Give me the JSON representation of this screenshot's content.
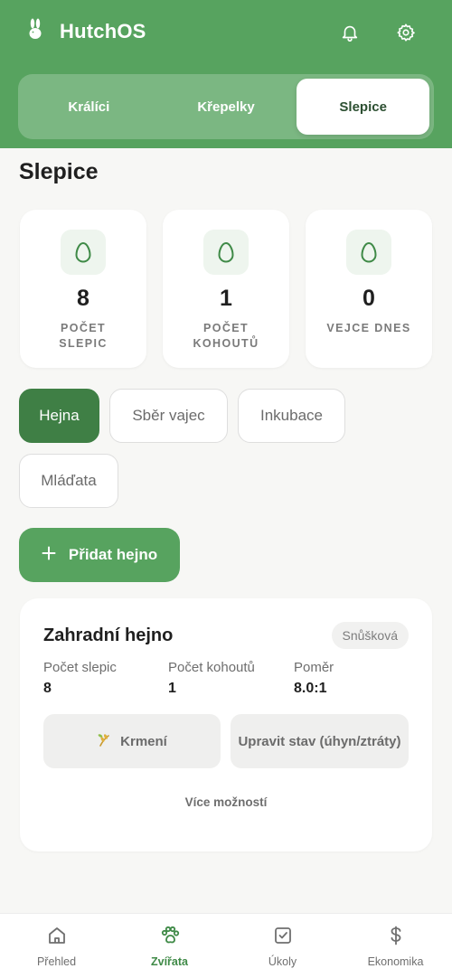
{
  "app": {
    "name": "HutchOS"
  },
  "header": {
    "icons": [
      "bell-icon",
      "gear-icon"
    ]
  },
  "tabs": [
    {
      "label": "Králíci",
      "active": false
    },
    {
      "label": "Křepelky",
      "active": false
    },
    {
      "label": "Slepice",
      "active": true
    }
  ],
  "page": {
    "title": "Slepice"
  },
  "stats": [
    {
      "value": "8",
      "label": "POČET SLEPIC",
      "icon": "egg-icon"
    },
    {
      "value": "1",
      "label": "POČET KOHOUTŮ",
      "icon": "egg-icon"
    },
    {
      "value": "0",
      "label": "VEJCE DNES",
      "icon": "egg-icon"
    }
  ],
  "filters": [
    {
      "label": "Hejna",
      "active": true
    },
    {
      "label": "Sběr vajec",
      "active": false
    },
    {
      "label": "Inkubace",
      "active": false
    },
    {
      "label": "Mláďata",
      "active": false
    }
  ],
  "add_button": {
    "label": "Přidat hejno"
  },
  "flock_card": {
    "title": "Zahradní hejno",
    "badge": "Snůšková",
    "fields": [
      {
        "label": "Počet slepic",
        "value": "8"
      },
      {
        "label": "Počet kohoutů",
        "value": "1"
      },
      {
        "label": "Poměr",
        "value": "8.0:1"
      }
    ],
    "actions": {
      "feed": "Krmení",
      "update": "Upravit stav (úhyn/ztráty)"
    },
    "more": "Více možností"
  },
  "nav": [
    {
      "label": "Přehled",
      "icon": "home-icon",
      "active": false
    },
    {
      "label": "Zvířata",
      "icon": "paw-icon",
      "active": true
    },
    {
      "label": "Úkoly",
      "icon": "checkbox-icon",
      "active": false
    },
    {
      "label": "Ekonomika",
      "icon": "dollar-icon",
      "active": false
    }
  ],
  "colors": {
    "primary": "#57a35f",
    "primary_dark": "#3f7f45",
    "background": "#f7f7f5"
  }
}
